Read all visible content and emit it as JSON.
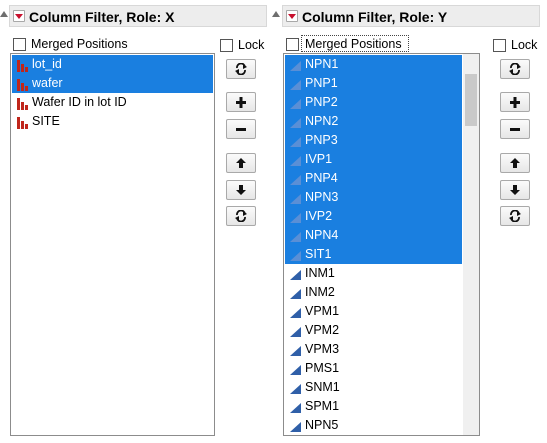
{
  "left_panel": {
    "title": "Column Filter, Role: X",
    "merged_label": "Merged Positions",
    "merged_checked": false,
    "lock_label": "Lock",
    "lock_checked": false,
    "columns": [
      {
        "label": "lot_id",
        "selected": true,
        "icon": "nominal-bar-icon"
      },
      {
        "label": "wafer",
        "selected": true,
        "icon": "nominal-bar-icon"
      },
      {
        "label": "Wafer ID in lot ID",
        "selected": false,
        "icon": "nominal-bar-icon"
      },
      {
        "label": "SITE",
        "selected": false,
        "icon": "nominal-bar-icon"
      }
    ],
    "buttons": [
      "refresh-button",
      "add-button",
      "remove-button",
      "move-up-button",
      "move-down-button",
      "reset-button"
    ]
  },
  "right_panel": {
    "title": "Column Filter, Role: Y",
    "merged_label": "Merged Positions",
    "merged_checked": false,
    "lock_label": "Lock",
    "lock_checked": false,
    "columns": [
      {
        "label": "NPN1",
        "selected": true,
        "icon": "continuous-triangle-icon"
      },
      {
        "label": "PNP1",
        "selected": true,
        "icon": "continuous-triangle-icon"
      },
      {
        "label": "PNP2",
        "selected": true,
        "icon": "continuous-triangle-icon"
      },
      {
        "label": "NPN2",
        "selected": true,
        "icon": "continuous-triangle-icon"
      },
      {
        "label": "PNP3",
        "selected": true,
        "icon": "continuous-triangle-icon"
      },
      {
        "label": "IVP1",
        "selected": true,
        "icon": "continuous-triangle-icon"
      },
      {
        "label": "PNP4",
        "selected": true,
        "icon": "continuous-triangle-icon"
      },
      {
        "label": "NPN3",
        "selected": true,
        "icon": "continuous-triangle-icon"
      },
      {
        "label": "IVP2",
        "selected": true,
        "icon": "continuous-triangle-icon"
      },
      {
        "label": "NPN4",
        "selected": true,
        "icon": "continuous-triangle-icon"
      },
      {
        "label": "SIT1",
        "selected": true,
        "icon": "continuous-triangle-icon"
      },
      {
        "label": "INM1",
        "selected": false,
        "icon": "continuous-triangle-icon"
      },
      {
        "label": "INM2",
        "selected": false,
        "icon": "continuous-triangle-icon"
      },
      {
        "label": "VPM1",
        "selected": false,
        "icon": "continuous-triangle-icon"
      },
      {
        "label": "VPM2",
        "selected": false,
        "icon": "continuous-triangle-icon"
      },
      {
        "label": "VPM3",
        "selected": false,
        "icon": "continuous-triangle-icon"
      },
      {
        "label": "PMS1",
        "selected": false,
        "icon": "continuous-triangle-icon"
      },
      {
        "label": "SNM1",
        "selected": false,
        "icon": "continuous-triangle-icon"
      },
      {
        "label": "SPM1",
        "selected": false,
        "icon": "continuous-triangle-icon"
      },
      {
        "label": "NPN5",
        "selected": false,
        "icon": "continuous-triangle-icon"
      }
    ],
    "buttons": [
      "refresh-button",
      "add-button",
      "remove-button",
      "move-up-button",
      "move-down-button",
      "reset-button"
    ]
  },
  "colors": {
    "selection": "#1a7fe0",
    "nominal_icon": "#c0261c",
    "continuous_icon": "#2f5fa8",
    "header_bg": "#ededed"
  }
}
